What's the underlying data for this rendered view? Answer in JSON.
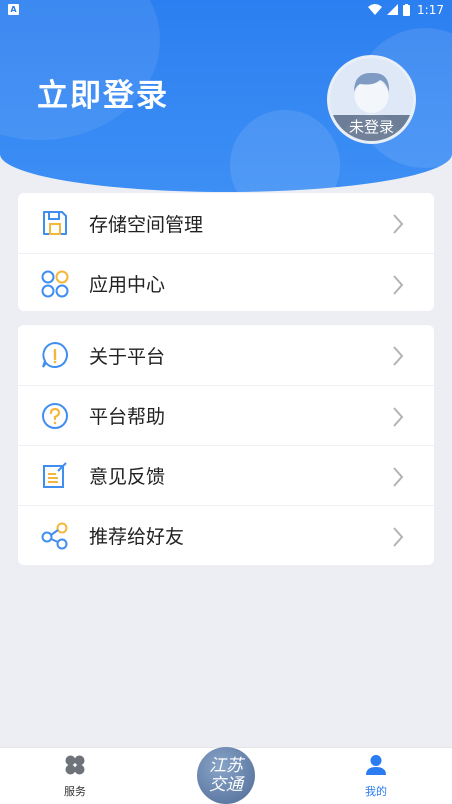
{
  "status_bar": {
    "notification_icon": "android-a-icon",
    "time": "1:17"
  },
  "header": {
    "title": "立即登录",
    "avatar_label": "未登录"
  },
  "menu_groups": [
    {
      "items": [
        {
          "label": "存储空间管理",
          "icon": "floppy-disk-icon"
        },
        {
          "label": "应用中心",
          "icon": "app-circles-icon"
        }
      ]
    },
    {
      "items": [
        {
          "label": "关于平台",
          "icon": "info-icon"
        },
        {
          "label": "平台帮助",
          "icon": "question-icon"
        },
        {
          "label": "意见反馈",
          "icon": "feedback-edit-icon"
        },
        {
          "label": "推荐给好友",
          "icon": "share-icon"
        }
      ]
    }
  ],
  "bottom_nav": {
    "services_label": "服务",
    "center_logo_text_1": "江苏",
    "center_logo_text_2": "交通",
    "mine_label": "我的"
  },
  "colors": {
    "brand_blue": "#2c7ff0",
    "icon_blue": "#3f8ef0",
    "icon_yellow": "#f4b73b"
  }
}
